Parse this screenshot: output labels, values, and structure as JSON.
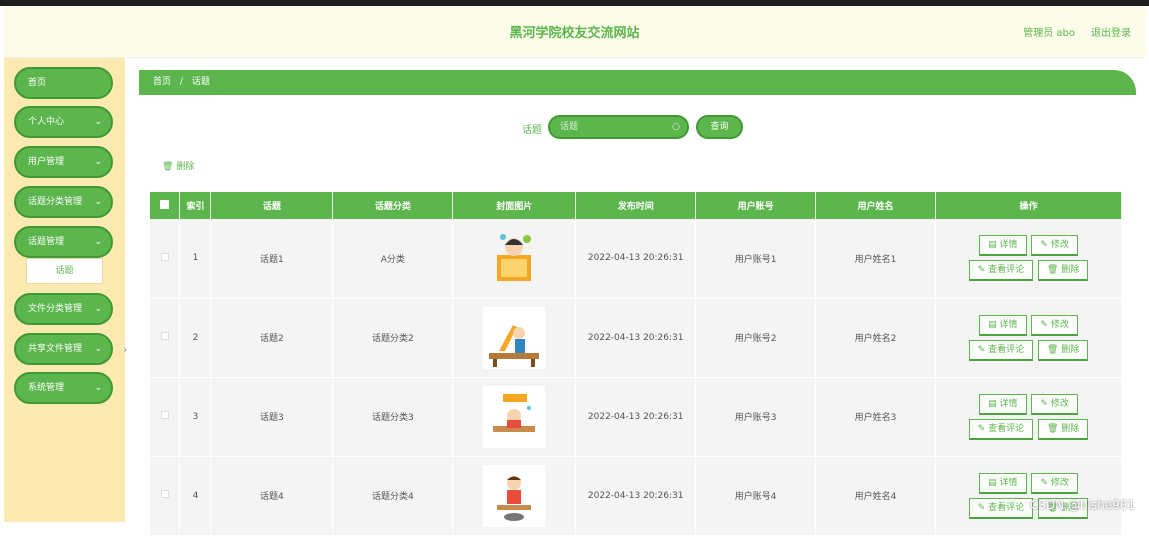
{
  "header": {
    "site_title": "黑河学院校友交流网站",
    "admin_label": "管理员 abo",
    "logout_label": "退出登录"
  },
  "sidebar": {
    "items": [
      {
        "label": "首页",
        "has_chevron": false
      },
      {
        "label": "个人中心",
        "has_chevron": true
      },
      {
        "label": "用户管理",
        "has_chevron": true
      },
      {
        "label": "话题分类管理",
        "has_chevron": true
      },
      {
        "label": "话题管理",
        "has_chevron": true
      },
      {
        "label": "文件分类管理",
        "has_chevron": true
      },
      {
        "label": "共享文件管理",
        "has_chevron": true
      },
      {
        "label": "系统管理",
        "has_chevron": true
      }
    ],
    "sub_item": "话题",
    "collapse_glyph": "›"
  },
  "breadcrumb": {
    "home": "首页",
    "separator": "/",
    "current": "话题"
  },
  "search": {
    "label": "话题",
    "placeholder": "话题",
    "button": "查询"
  },
  "toolbar": {
    "delete_label": "删除"
  },
  "table": {
    "headers": [
      "",
      "索引",
      "话题",
      "话题分类",
      "封面图片",
      "发布时间",
      "用户账号",
      "用户姓名",
      "操作"
    ],
    "rows": [
      {
        "index": "1",
        "topic": "话题1",
        "category": "A分类",
        "time": "2022-04-13 20:26:31",
        "account": "用户账号1",
        "name": "用户姓名1"
      },
      {
        "index": "2",
        "topic": "话题2",
        "category": "话题分类2",
        "time": "2022-04-13 20:26:31",
        "account": "用户账号2",
        "name": "用户姓名2"
      },
      {
        "index": "3",
        "topic": "话题3",
        "category": "话题分类3",
        "time": "2022-04-13 20:26:31",
        "account": "用户账号3",
        "name": "用户姓名3"
      },
      {
        "index": "4",
        "topic": "话题4",
        "category": "话题分类4",
        "time": "2022-04-13 20:26:31",
        "account": "用户账号4",
        "name": "用户姓名4"
      }
    ],
    "actions": {
      "detail": "详情",
      "edit": "修改",
      "comments": "查看评论",
      "delete": "删除"
    }
  },
  "watermark": "CSDN @bishe901",
  "colors": {
    "accent": "#5cb54d",
    "sidebar_bg": "#fde9b2",
    "header_bg": "#fbfdea"
  }
}
